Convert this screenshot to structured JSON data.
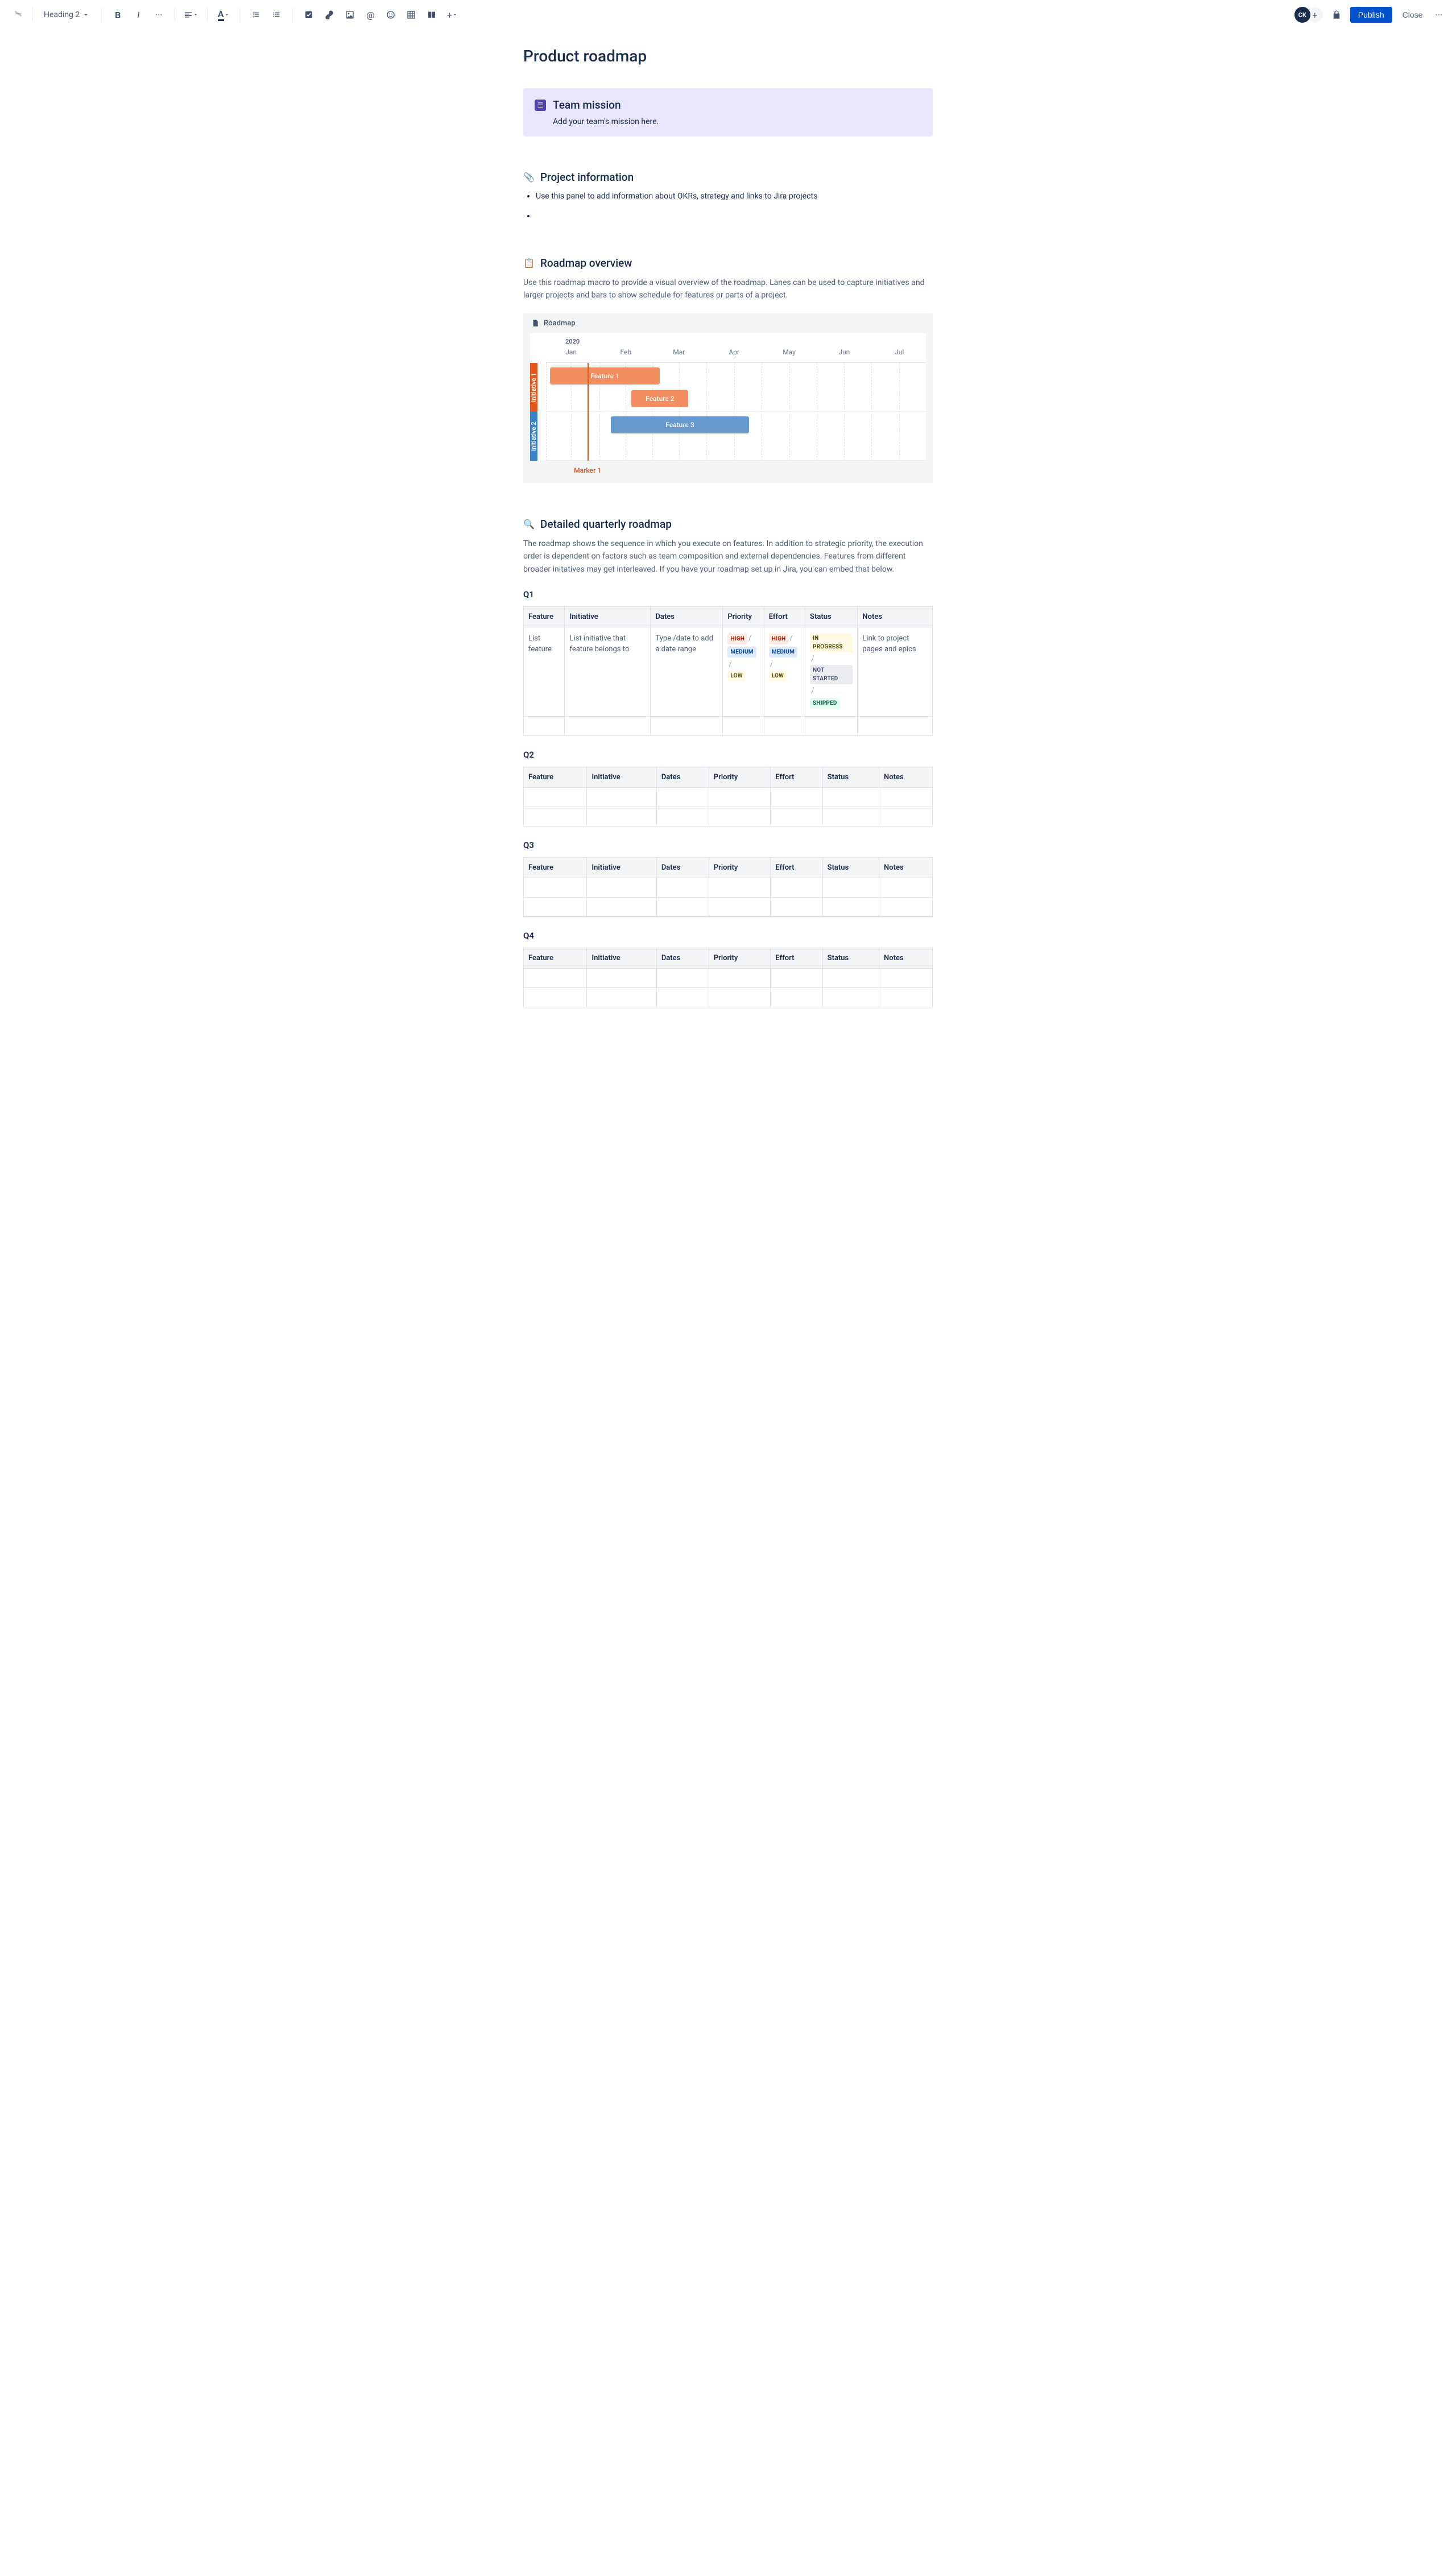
{
  "toolbar": {
    "text_style": "Heading 2",
    "avatar_initials": "CK",
    "publish": "Publish",
    "close": "Close"
  },
  "page": {
    "title": "Product roadmap"
  },
  "panel": {
    "title": "Team mission",
    "body": "Add your team's mission here."
  },
  "project_info": {
    "heading": "Project information",
    "bullet": "Use this panel to add information about OKRs, strategy and links to Jira projects"
  },
  "roadmap_overview": {
    "heading": "Roadmap overview",
    "body": "Use this roadmap macro to provide a visual overview of the roadmap. Lanes can be used to capture initiatives and larger projects and bars to show schedule for features or parts of a project.",
    "card_title": "Roadmap",
    "year": "2020",
    "months": [
      "Jan",
      "Feb",
      "Mar",
      "Apr",
      "May",
      "Jun",
      "Jul"
    ],
    "lanes": [
      "Initiative 1",
      "Initiative 2"
    ],
    "features": {
      "f1": "Feature 1",
      "f2": "Feature 2",
      "f3": "Feature 3"
    },
    "marker": "Marker 1"
  },
  "detailed": {
    "heading": "Detailed quarterly roadmap",
    "body": "The roadmap shows the sequence in which you execute on features. In addition to strategic priority, the execution order is dependent on factors such as team composition and external dependencies. Features from different broader initatives may get interleaved. If you have your roadmap set up in Jira, you can embed that below."
  },
  "table": {
    "columns": [
      "Feature",
      "Initiative",
      "Dates",
      "Priority",
      "Effort",
      "Status",
      "Notes"
    ],
    "q1": {
      "label": "Q1",
      "row": {
        "feature": "List feature",
        "initiative": "List initiative that feature belongs to",
        "dates": "Type /date to add a date range",
        "priority": [
          "HIGH",
          "MEDIUM",
          "LOW"
        ],
        "effort": [
          "HIGH",
          "MEDIUM",
          "LOW"
        ],
        "status": [
          "IN PROGRESS",
          "NOT STARTED",
          "SHIPPED"
        ],
        "notes": "Link to project pages and epics"
      }
    },
    "q2": {
      "label": "Q2"
    },
    "q3": {
      "label": "Q3"
    },
    "q4": {
      "label": "Q4"
    }
  }
}
